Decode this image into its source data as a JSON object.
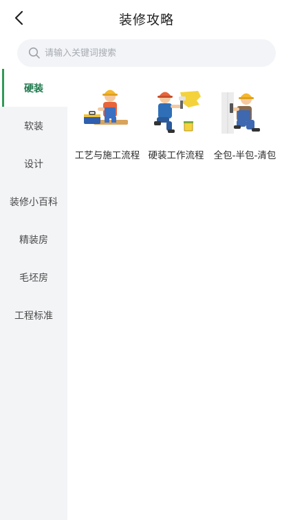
{
  "header": {
    "title": "装修攻略",
    "back_icon": "chevron-left-icon"
  },
  "search": {
    "placeholder": "请输入关键词搜索",
    "icon": "search-icon"
  },
  "sidebar": {
    "items": [
      {
        "label": "硬装",
        "active": true
      },
      {
        "label": "软装",
        "active": false
      },
      {
        "label": "设计",
        "active": false
      },
      {
        "label": "装修小百科",
        "active": false
      },
      {
        "label": "精装房",
        "active": false
      },
      {
        "label": "毛坯房",
        "active": false
      },
      {
        "label": "工程标准",
        "active": false
      }
    ]
  },
  "content": {
    "cards": [
      {
        "label": "工艺与施工流程",
        "icon": "worker-toolbox-icon"
      },
      {
        "label": "硬装工作流程",
        "icon": "worker-painting-icon"
      },
      {
        "label": "全包-半包-清包",
        "icon": "worker-wall-icon"
      }
    ]
  },
  "colors": {
    "accent": "#2e9b55",
    "active_text": "#1f7a4d",
    "sidebar_bg": "#f3f4f6",
    "search_bg": "#f2f4f7"
  }
}
